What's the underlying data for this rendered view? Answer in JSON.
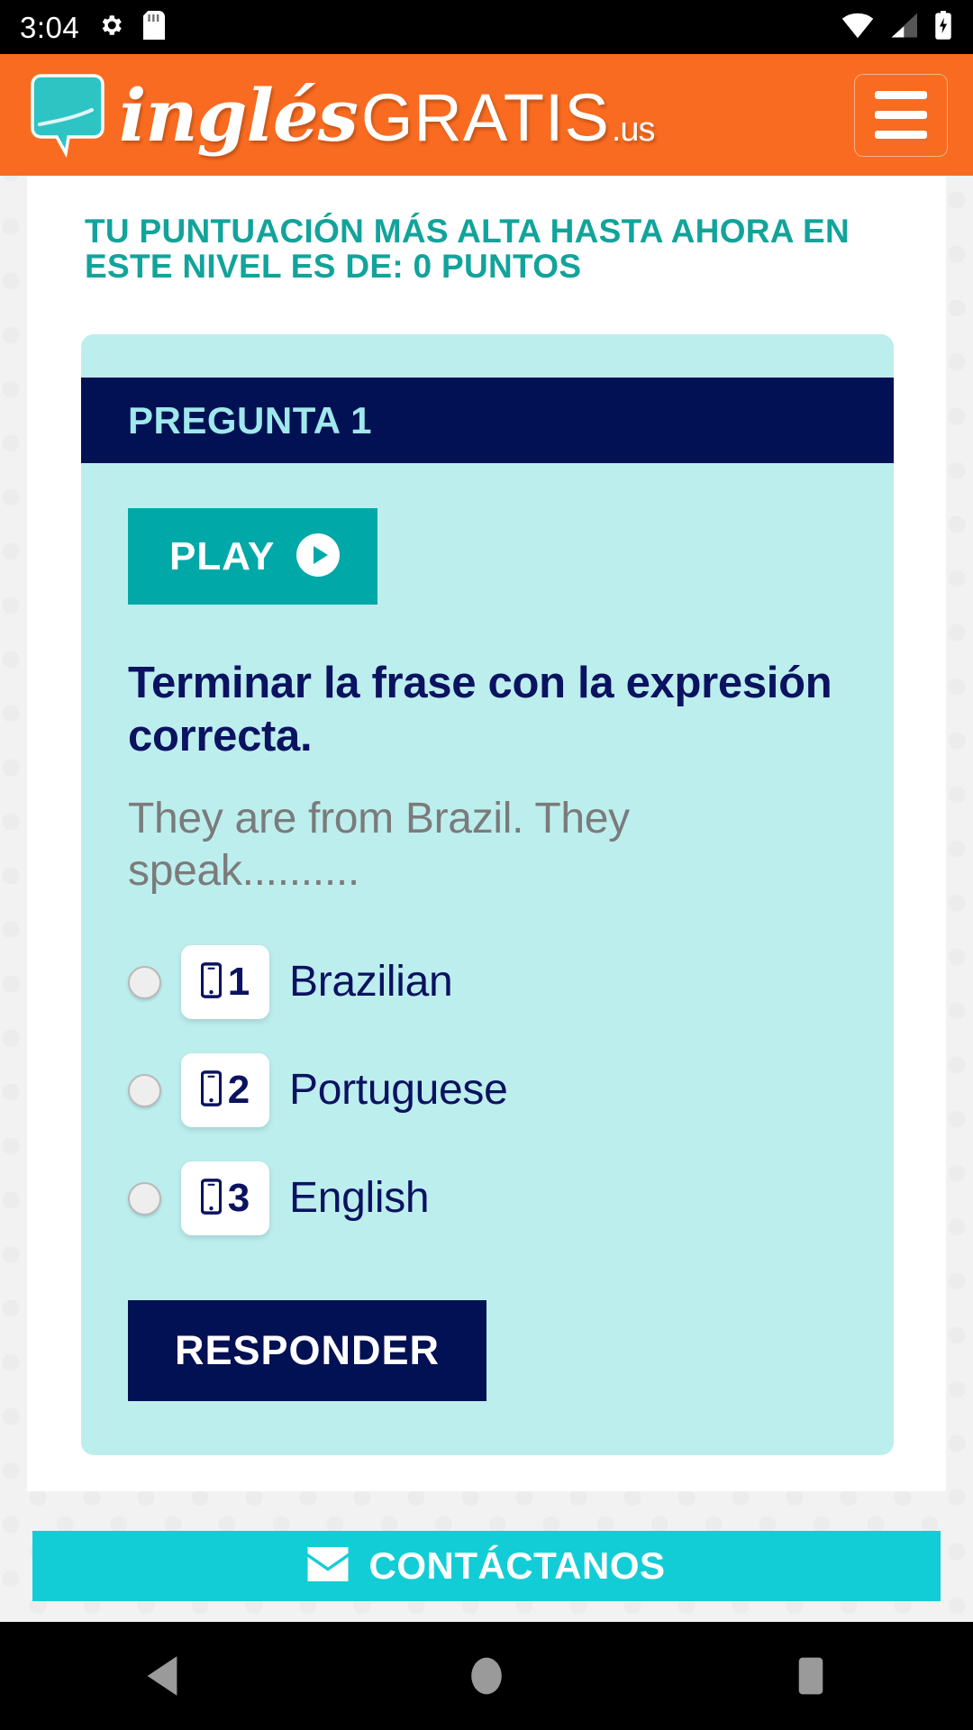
{
  "status_bar": {
    "time": "3:04",
    "icons": [
      "settings-gear-icon",
      "sd-card-icon",
      "wifi-icon",
      "cellular-signal-icon",
      "battery-charging-icon"
    ]
  },
  "header": {
    "logo_icon": "speech-bubble-icon",
    "brand_part1": "inglés",
    "brand_part2": "GRATIS",
    "brand_tld": ".us",
    "menu_icon": "hamburger-menu-icon"
  },
  "main": {
    "score_text": "TU PUNTUACIÓN MÁS ALTA HASTA AHORA EN ESTE NIVEL ES DE: 0 PUNTOS",
    "question_header": "PREGUNTA 1",
    "play_label": "PLAY",
    "play_icon": "play-circle-icon",
    "question_title": "Terminar la frase con la expresión correcta.",
    "question_prompt": "They are from Brazil. They speak..........",
    "options": [
      {
        "number": "1",
        "label": "Brazilian",
        "icon": "mobile-phone-icon",
        "selected": false
      },
      {
        "number": "2",
        "label": "Portuguese",
        "icon": "mobile-phone-icon",
        "selected": false
      },
      {
        "number": "3",
        "label": "English",
        "icon": "mobile-phone-icon",
        "selected": false
      }
    ],
    "answer_label": "RESPONDER"
  },
  "footer": {
    "contact_label": "CONTÁCTANOS",
    "contact_icon": "envelope-icon"
  },
  "navigation_bar": {
    "back_icon": "back-triangle-icon",
    "home_icon": "home-circle-icon",
    "recents_icon": "recents-square-icon"
  },
  "colors": {
    "brand_orange": "#f96b20",
    "teal": "#12a39b",
    "navy": "#021054",
    "card_cyan": "#bdeeee",
    "cyan_accent": "#13cdd6",
    "play_teal": "#00a8a8",
    "prompt_gray": "#7b7b7b"
  }
}
